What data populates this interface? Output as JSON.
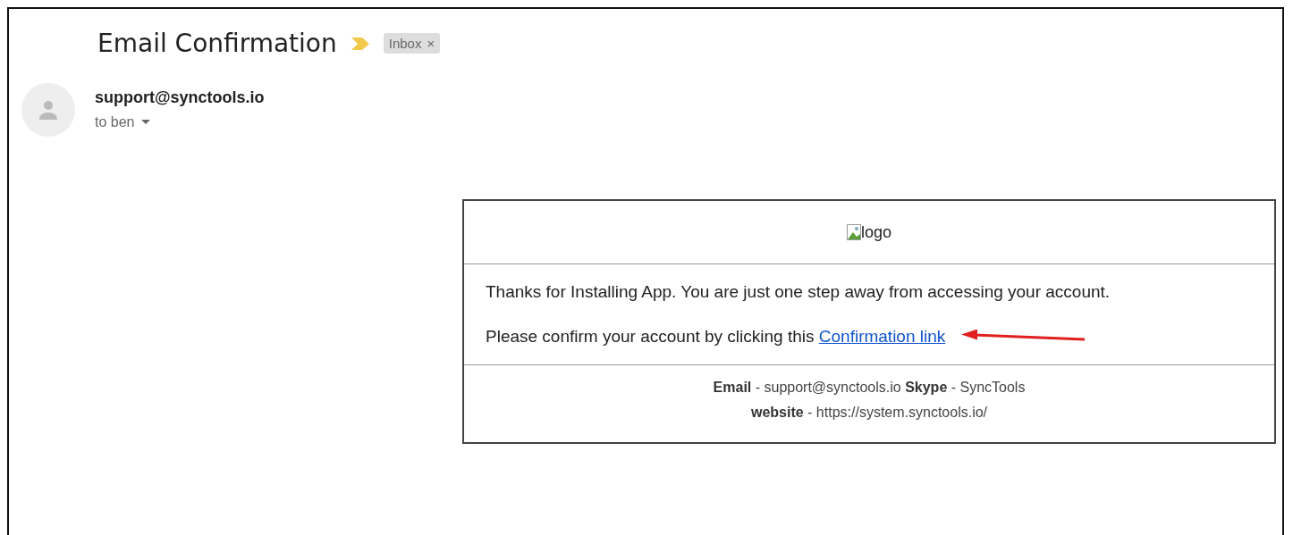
{
  "email": {
    "subject": "Email Confirmation",
    "label": {
      "text": "Inbox",
      "close": "×"
    },
    "sender": "support@synctools.io",
    "recipient": "to ben"
  },
  "message": {
    "logo_alt": "logo",
    "paragraphs": [
      {
        "text": "Thanks for Installing App. You are just one step away from accessing your account."
      },
      {
        "text": "Please confirm your account by clicking this ",
        "link": "Confirmation link",
        "annotated": true
      }
    ],
    "footer": [
      "**Email** - support@synctools.io **Skype** - SyncTools",
      "**website** - https://system.synctools.io/"
    ]
  }
}
